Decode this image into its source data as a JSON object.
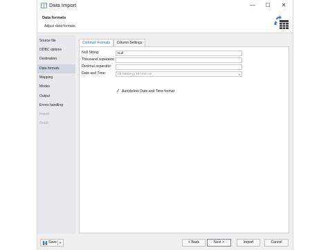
{
  "window": {
    "title": "Data Import",
    "minimize_glyph": "—",
    "maximize_glyph": "☐",
    "close_glyph": "✕"
  },
  "header": {
    "title": "Data formats",
    "subtitle": "Adjust data formats.",
    "icon": "import-table-icon"
  },
  "sidebar": {
    "items": [
      {
        "label": "Source file",
        "state": "normal"
      },
      {
        "label": "ODBC options",
        "state": "normal"
      },
      {
        "label": "Destination",
        "state": "normal"
      },
      {
        "label": "Data formats",
        "state": "active"
      },
      {
        "label": "Mapping",
        "state": "normal"
      },
      {
        "label": "Modes",
        "state": "normal"
      },
      {
        "label": "Output",
        "state": "normal"
      },
      {
        "label": "Errors handling",
        "state": "normal"
      },
      {
        "label": "Import",
        "state": "disabled"
      },
      {
        "label": "Finish",
        "state": "disabled"
      }
    ]
  },
  "tabs": [
    {
      "label": "Common Formats",
      "active": true
    },
    {
      "label": "Column Settings",
      "active": false
    }
  ],
  "form": {
    "null_string": {
      "label": "Null String:",
      "value": "Null"
    },
    "thousand_separator": {
      "label": "Thousand separator:",
      "value": ""
    },
    "decimal_separator": {
      "label": "Decimal separator:",
      "value": "."
    },
    "date_time": {
      "label": "Date and Time:",
      "value": "dd-MMM-yy HH:mm:ss"
    },
    "autodetect": {
      "label": "Autodetect Date and Time format",
      "checked": true,
      "glyph": "✓"
    }
  },
  "footer": {
    "save_label": "Save",
    "save_caret": "▾",
    "back_label": "< Back",
    "next_label": "Next >",
    "import_label": "Import",
    "cancel_label": "Cancel"
  },
  "colors": {
    "accent": "#2a6fbf",
    "sidebar_bg": "#e8e8ed",
    "sidebar_active": "#d2d7e2"
  }
}
